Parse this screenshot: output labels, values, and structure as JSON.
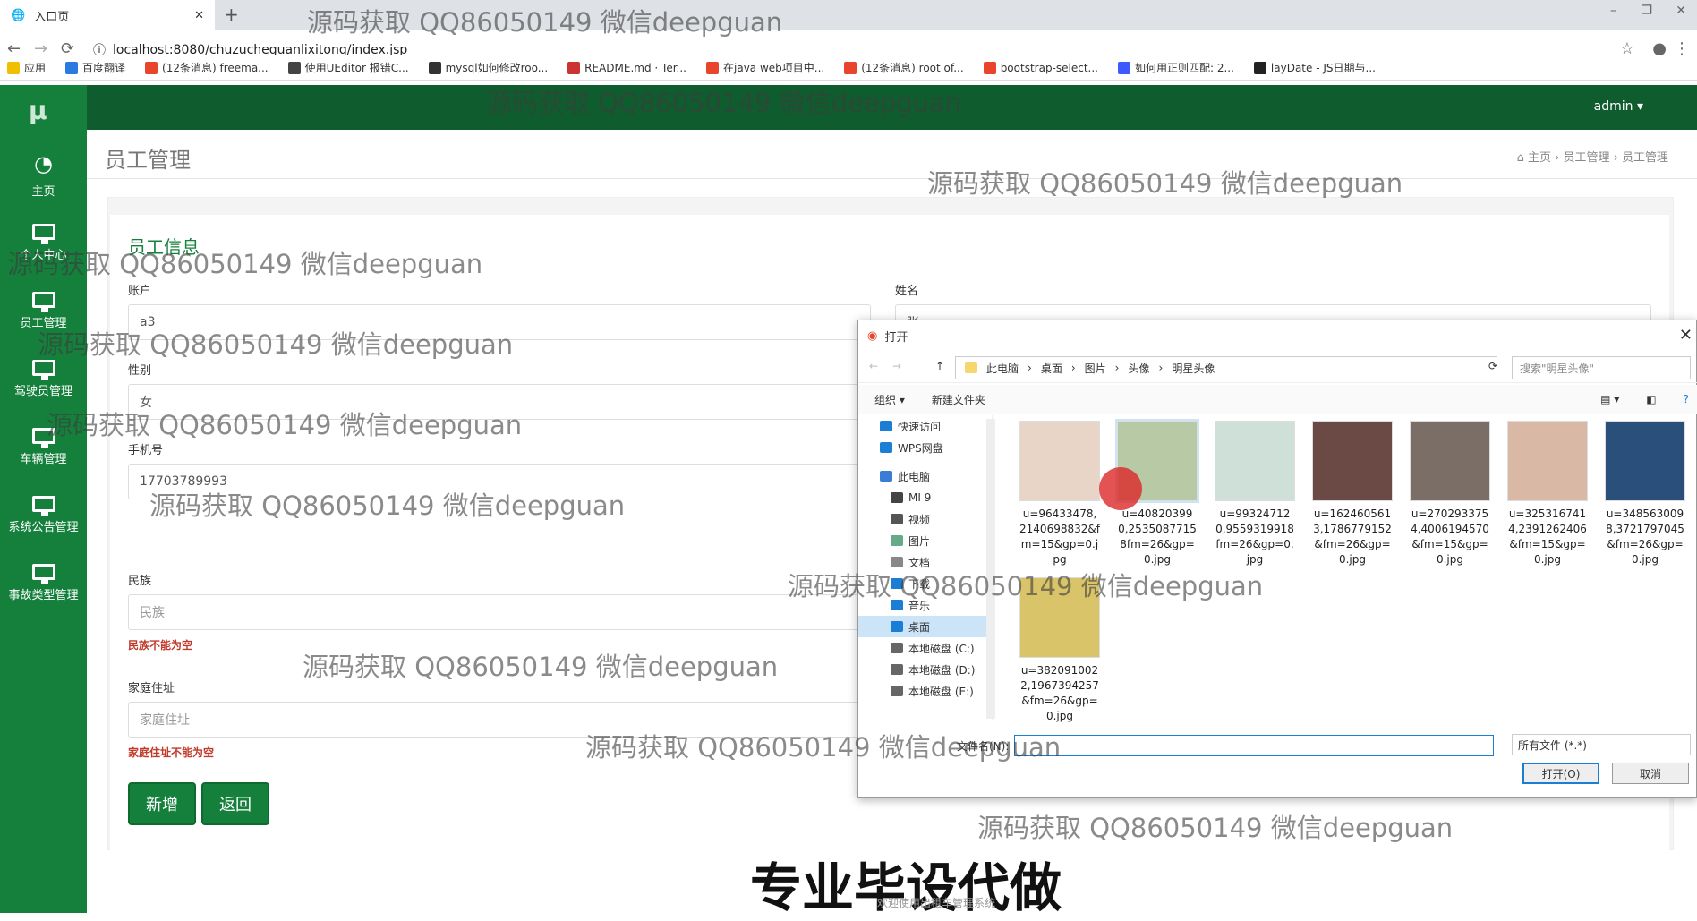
{
  "browser": {
    "tab_title": "入口页",
    "url": "localhost:8080/chuzucheguanlixitong/index.jsp",
    "bookmarks": [
      "应用",
      "百度翻译",
      "(12条消息) freema...",
      "使用UEditor 报错C...",
      "mysql如何修改roo...",
      "README.md · Ter...",
      "在java web项目中...",
      "(12条消息) root of...",
      "bootstrap-select...",
      "如何用正则匹配: 2...",
      "layDate - JS日期与..."
    ],
    "bookmark_colors": [
      "#f0c000",
      "#2a7ae2",
      "#e8452c",
      "#444",
      "#333",
      "#c33",
      "#e8452c",
      "#e8452c",
      "#e8452c",
      "#3d5afe",
      "#222"
    ]
  },
  "topbar": {
    "logo": "μ",
    "user": "admin ▾"
  },
  "sidebar": {
    "items": [
      {
        "label": "主页",
        "icon": "dashboard-icon"
      },
      {
        "label": "个人中心",
        "icon": "monitor-icon"
      },
      {
        "label": "员工管理",
        "icon": "monitor-icon"
      },
      {
        "label": "驾驶员管理",
        "icon": "monitor-icon"
      },
      {
        "label": "车辆管理",
        "icon": "monitor-icon"
      },
      {
        "label": "系统公告管理",
        "icon": "monitor-icon"
      },
      {
        "label": "事故类型管理",
        "icon": "monitor-icon"
      }
    ]
  },
  "page": {
    "title": "员工管理",
    "breadcrumb": [
      "主页",
      "员工管理",
      "员工管理"
    ]
  },
  "form": {
    "section": "员工信息",
    "account_label": "账户",
    "account_value": "a3",
    "name_label": "姓名",
    "name_value": "张s",
    "gender_label": "性别",
    "gender_value": "女",
    "phone_label": "手机号",
    "phone_value": "17703789993",
    "ethnic_label": "民族",
    "ethnic_placeholder": "民族",
    "ethnic_error": "民族不能为空",
    "address_label": "家庭住址",
    "address_placeholder": "家庭住址",
    "address_error": "家庭住址不能为空",
    "add_button": "新增",
    "back_button": "返回"
  },
  "dialog": {
    "title": "打开",
    "path": [
      "此电脑",
      "桌面",
      "图片",
      "头像",
      "明星头像"
    ],
    "search_placeholder": "搜索\"明星头像\"",
    "organize": "组织 ▾",
    "new_folder": "新建文件夹",
    "tree": [
      "快速访问",
      "WPS网盘",
      "此电脑",
      "MI 9",
      "视频",
      "图片",
      "文档",
      "下载",
      "音乐",
      "桌面",
      "本地磁盘 (C:)",
      "本地磁盘 (D:)",
      "本地磁盘 (E:)"
    ],
    "tree_colors": [
      "#1a7fd4",
      "#1a7fd4",
      "#3a7bd5",
      "#444",
      "#555",
      "#6a8",
      "#888",
      "#1a7fd4",
      "#1a7fd4",
      "#1a7fd4",
      "#666",
      "#666",
      "#666"
    ],
    "tree_selected": 9,
    "files": [
      {
        "name": "u=96433478,2140698832&fm=15&gp=0.jpg",
        "color": "#e9d4c8"
      },
      {
        "name": "u=408203990,25350877158fm=26&gp=0.jpg",
        "color": "#b8c9a5"
      },
      {
        "name": "u=993247120,9559319918fm=26&gp=0.jpg",
        "color": "#cfe0d8"
      },
      {
        "name": "u=1624605613,1786779152&fm=26&gp=0.jpg",
        "color": "#6b4a45"
      },
      {
        "name": "u=2702933754,4006194570&fm=15&gp=0.jpg",
        "color": "#7a6e66"
      },
      {
        "name": "u=3253167414,2391262406&fm=15&gp=0.jpg",
        "color": "#d9b9a6"
      },
      {
        "name": "u=3485630098,3721797045&fm=26&gp=0.jpg",
        "color": "#2a4f7a"
      },
      {
        "name": "u=3820910022,1967394257&fm=26&gp=0.jpg",
        "color": "#d9c46a"
      }
    ],
    "selected_file": 1,
    "filename_label": "文件名(N):",
    "filetype": "所有文件 (*.*)",
    "open_button": "打开(O)",
    "cancel_button": "取消"
  },
  "overlay": {
    "watermark": "源码获取 QQ86050149 微信deepguan",
    "slogan": "专业毕设代做",
    "footer": "欢迎使用出租车管理系统"
  }
}
